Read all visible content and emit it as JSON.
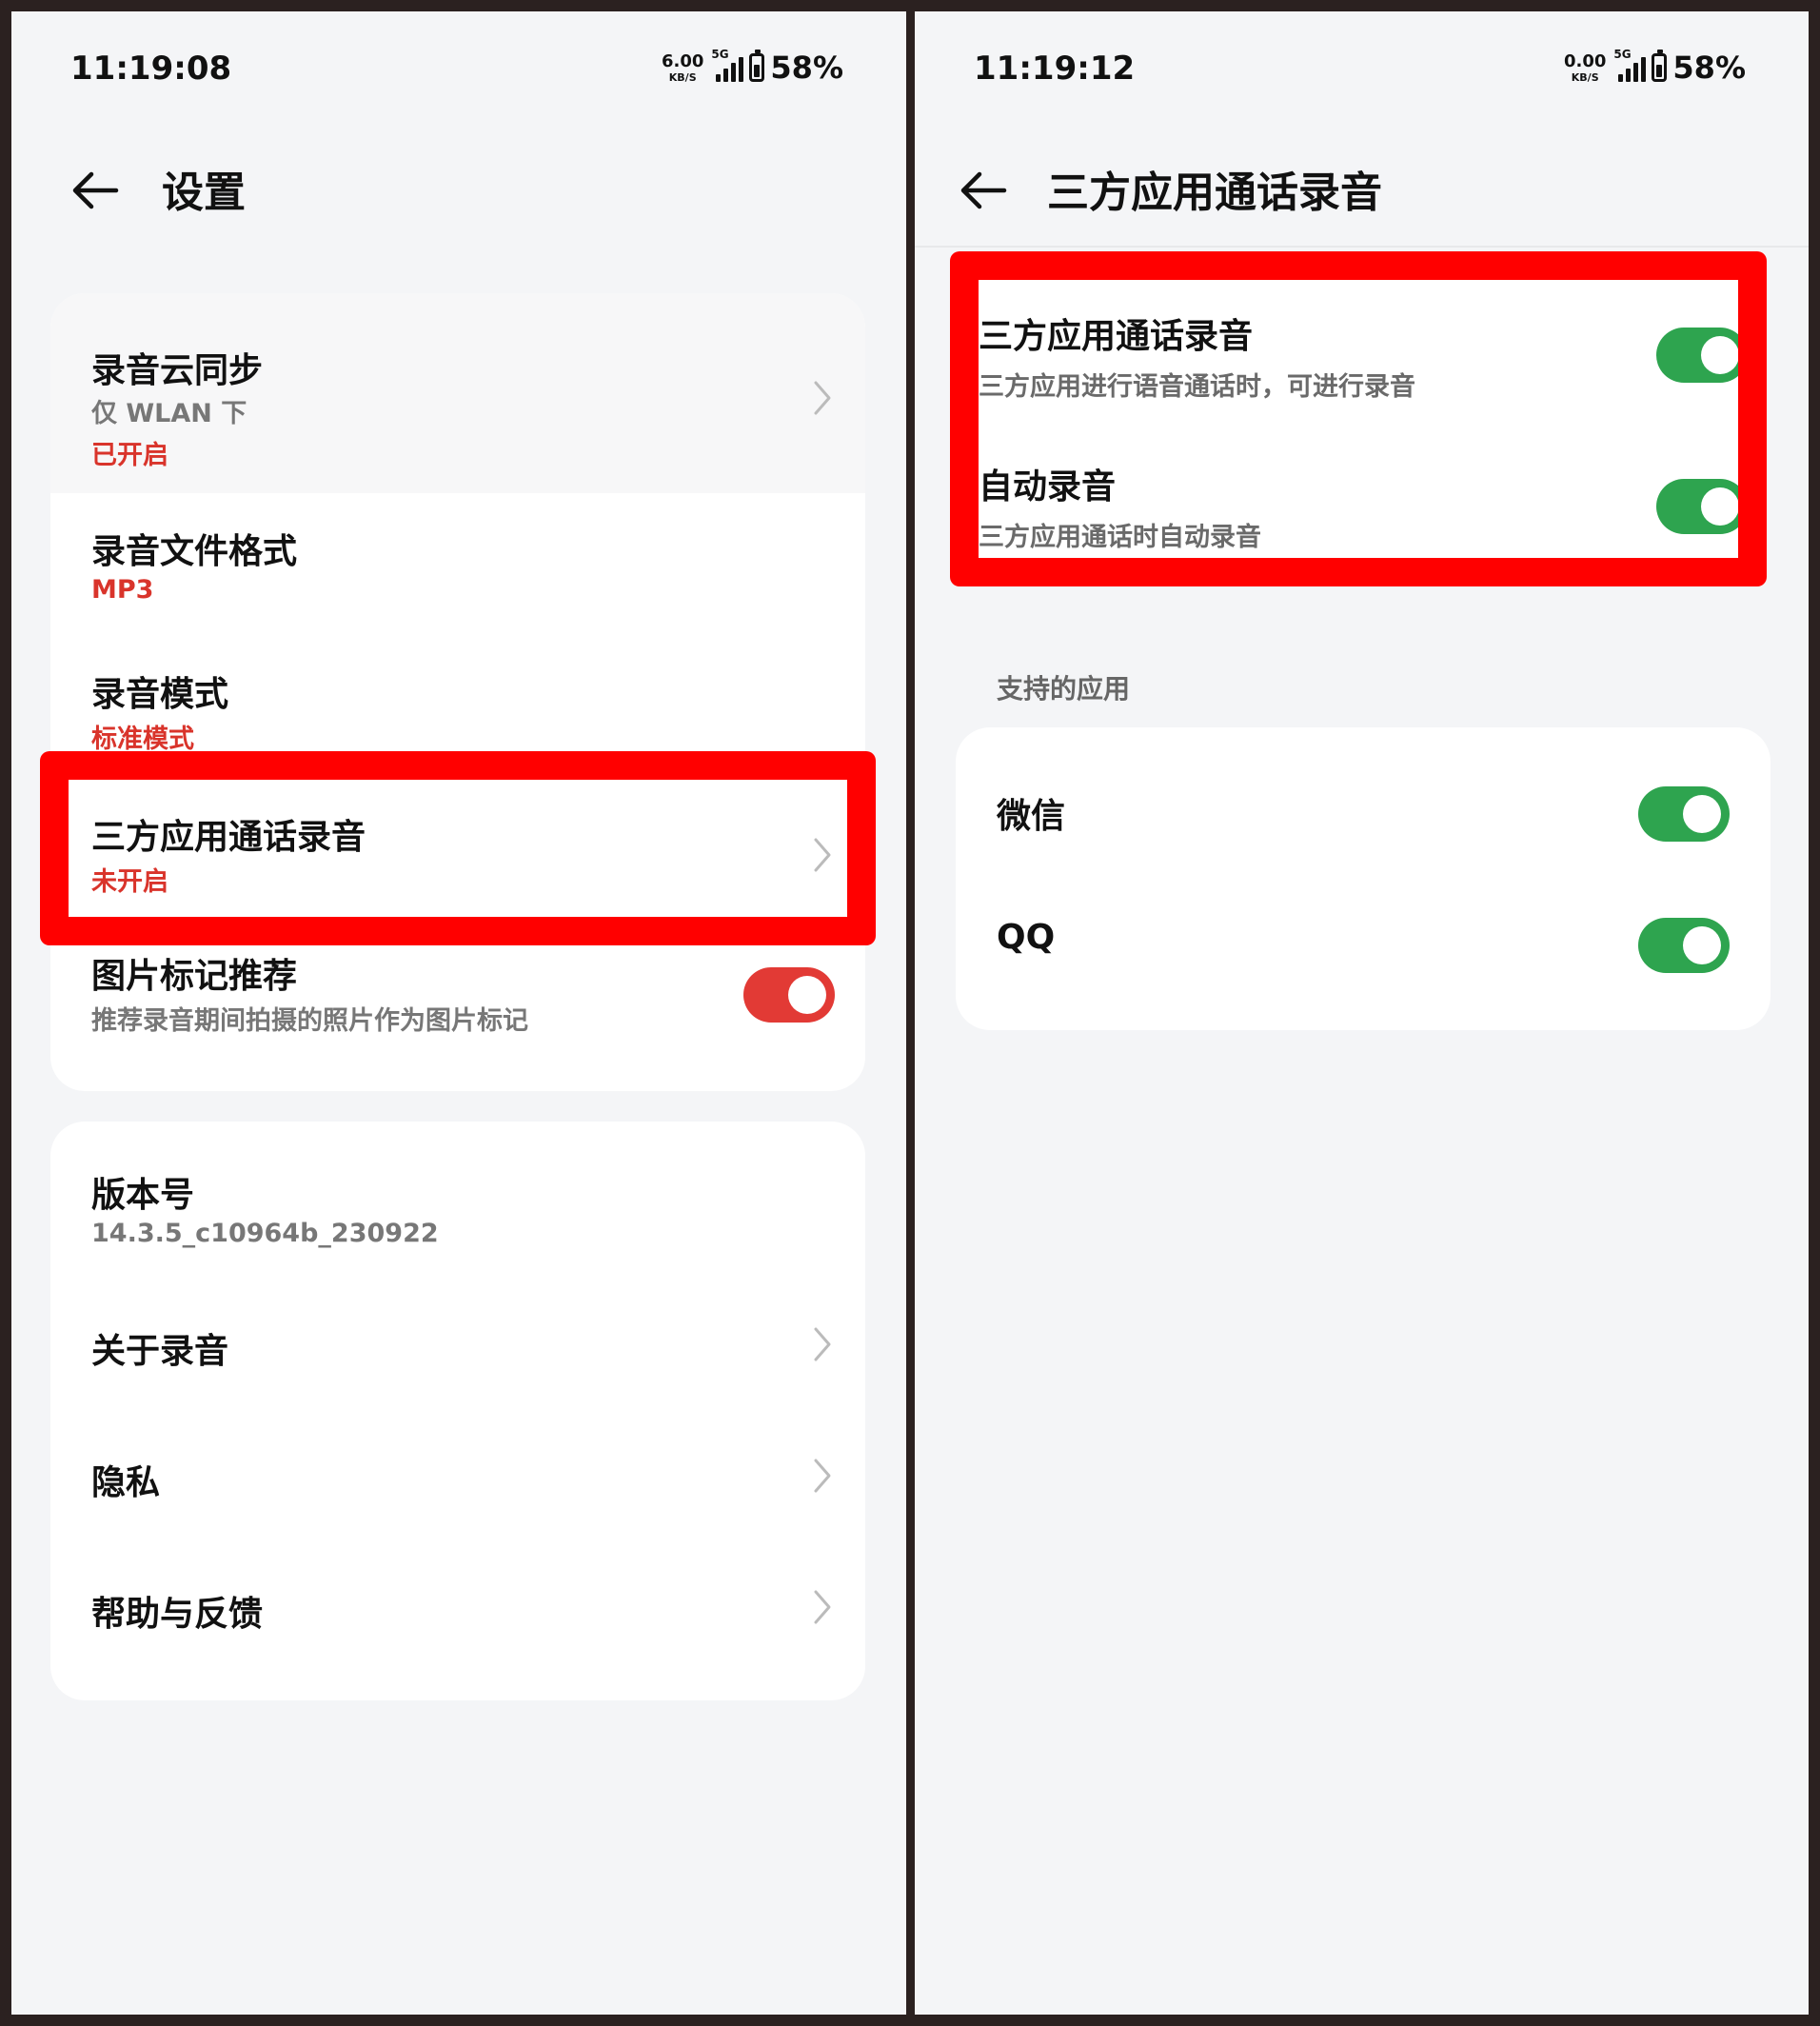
{
  "left": {
    "status": {
      "time": "11:19:08",
      "net_speed": "6.00",
      "net_unit": "KB/S",
      "network_type": "5G",
      "battery": "58%"
    },
    "header": {
      "back_icon": "arrow-left-icon",
      "title": "设置"
    },
    "settings_group": [
      {
        "title": "录音云同步",
        "subtitle": "仅 WLAN 下",
        "status": "已开启"
      },
      {
        "title": "录音文件格式",
        "status": "MP3"
      },
      {
        "title": "录音模式",
        "status": "标准模式"
      },
      {
        "title": "三方应用通话录音",
        "status": "未开启"
      },
      {
        "title": "图片标记推荐",
        "subtitle": "推荐录音期间拍摄的照片作为图片标记",
        "toggle_on": true
      }
    ],
    "about_group": [
      {
        "title": "版本号",
        "subtitle": "14.3.5_c10964b_230922"
      },
      {
        "title": "关于录音"
      },
      {
        "title": "隐私"
      },
      {
        "title": "帮助与反馈"
      }
    ],
    "toggle_color": "#e23a35"
  },
  "right": {
    "status": {
      "time": "11:19:12",
      "net_speed": "0.00",
      "net_unit": "KB/S",
      "network_type": "5G",
      "battery": "58%"
    },
    "header": {
      "back_icon": "arrow-left-icon",
      "title": "三方应用通话录音"
    },
    "main_settings": [
      {
        "title": "三方应用通话录音",
        "subtitle": "三方应用进行语音通话时，可进行录音",
        "toggle_on": true
      },
      {
        "title": "自动录音",
        "subtitle": "三方应用通话时自动录音",
        "toggle_on": true
      }
    ],
    "supported_label": "支持的应用",
    "apps": [
      {
        "name": "微信",
        "toggle_on": true
      },
      {
        "name": "QQ",
        "toggle_on": true
      }
    ],
    "toggle_color": "#2ea44f"
  },
  "highlight_color": "#ff0000"
}
